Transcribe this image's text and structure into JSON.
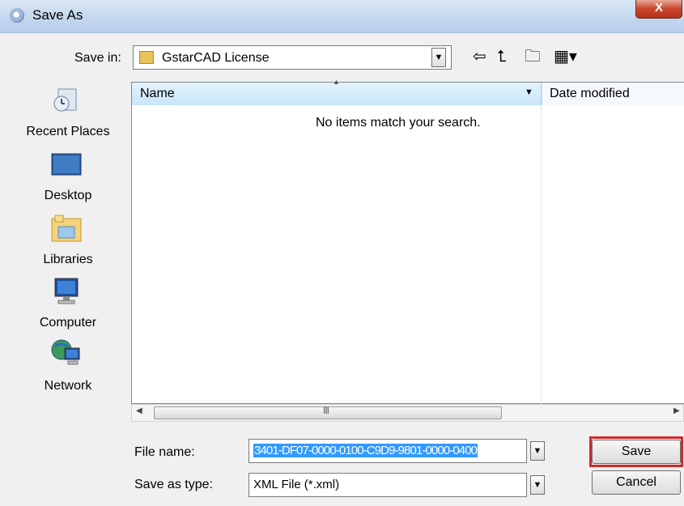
{
  "window": {
    "title": "Save As",
    "close_label": "X"
  },
  "toolbar": {
    "save_in_label": "Save in:",
    "save_in_value": "GstarCAD License",
    "back_icon": "back-arrow-icon",
    "up_icon": "up-folder-icon",
    "new_folder_icon": "new-folder-icon",
    "view_icon": "view-menu-icon"
  },
  "sidebar": {
    "items": [
      {
        "label": "Recent Places",
        "icon": "recent-places-icon"
      },
      {
        "label": "Desktop",
        "icon": "desktop-icon"
      },
      {
        "label": "Libraries",
        "icon": "libraries-icon"
      },
      {
        "label": "Computer",
        "icon": "computer-icon"
      },
      {
        "label": "Network",
        "icon": "network-icon"
      }
    ]
  },
  "filelist": {
    "columns": [
      "Name",
      "Date modified"
    ],
    "empty_message": "No items match your search.",
    "scroll_grip": "III"
  },
  "footer": {
    "file_name_label": "File name:",
    "file_name_value": "3401-DF07-0000-0100-C9D9-9801-0000-0400",
    "save_as_type_label": "Save as type:",
    "save_as_type_value": "XML File (*.xml)",
    "save_label": "Save",
    "cancel_label": "Cancel"
  },
  "colors": {
    "selection": "#3399ff",
    "highlight_border": "#d12a2a",
    "header_bg": "#c9e6f8"
  }
}
